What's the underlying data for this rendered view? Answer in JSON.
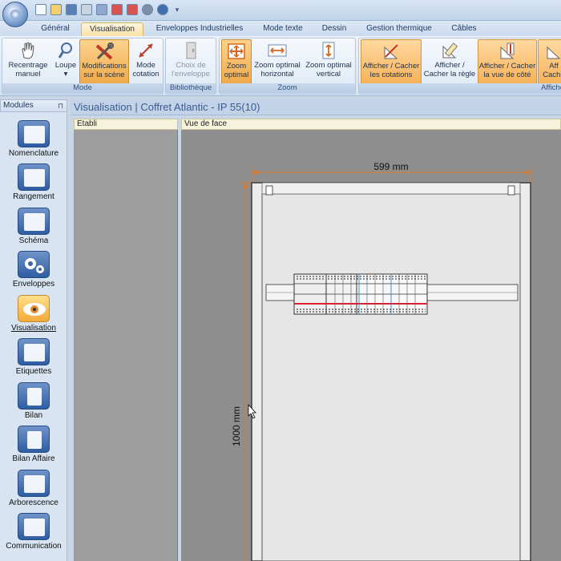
{
  "ribbon_tabs": [
    "Général",
    "Visualisation",
    "Enveloppes Industrielles",
    "Mode texte",
    "Dessin",
    "Gestion thermique",
    "Câbles"
  ],
  "ribbon": {
    "mode_group": {
      "label": "Mode",
      "btn_recentrage": "Recentrage manuel",
      "btn_loupe": "Loupe",
      "btn_modifications": "Modifications sur la scène",
      "btn_cotation": "Mode cotation"
    },
    "bibliotheque_group": {
      "label": "Bibliothèque",
      "btn_choix": "Choix de l'enveloppe"
    },
    "zoom_group": {
      "label": "Zoom",
      "btn_zoom_optimal": "Zoom optimal",
      "btn_zoom_h": "Zoom optimal horizontal",
      "btn_zoom_v": "Zoom optimal vertical"
    },
    "affichage_group": {
      "label": "Affiche",
      "btn_cotations": "Afficher / Cacher les cotations",
      "btn_regle": "Afficher / Cacher la règle",
      "btn_vue_cote": "Afficher / Cacher la vue de côté",
      "btn_partial_top": "Aff",
      "btn_partial_bottom": "Cache"
    }
  },
  "modules": {
    "title": "Modules",
    "items": [
      "Nomenclature",
      "Rangement",
      "Schéma",
      "Enveloppes",
      "Visualisation",
      "Etiquettes",
      "Bilan",
      "Bilan Affaire",
      "Arborescence",
      "Communication"
    ],
    "active": "Visualisation"
  },
  "document": {
    "title": "Visualisation | Coffret Atlantic - IP 55(10)",
    "etabli_label": "Etabli",
    "vue_label": "Vue de face"
  },
  "drawing": {
    "width_dim": "599 mm",
    "height_dim": "1000 mm"
  },
  "colors": {
    "accent_orange": "#f0a94a",
    "dimension_line": "#e07a2a",
    "ribbon_blue": "#d6e3f2"
  }
}
